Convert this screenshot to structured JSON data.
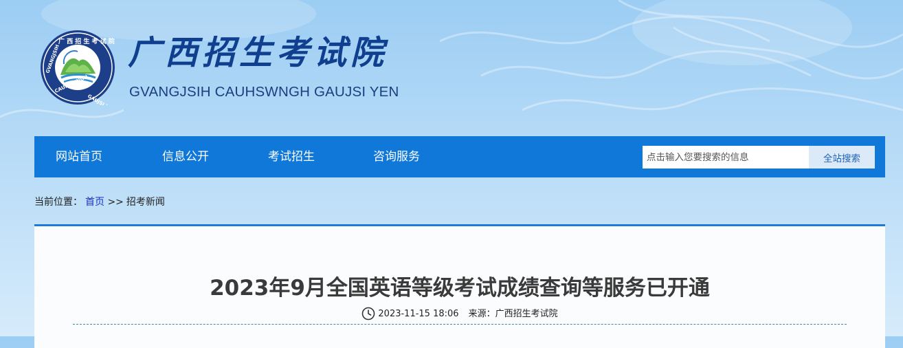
{
  "header": {
    "logo_ring_text": "GVANGJSIH CAUHSWNGH GAUJSI YEN",
    "logo_ring_cn": "广西招生考试院",
    "brand_cn": "广西招生考试院",
    "brand_en": "GVANGJSIH CAUHSWNGH GAUJSI YEN"
  },
  "nav": {
    "items": [
      {
        "label": "网站首页"
      },
      {
        "label": "信息公开"
      },
      {
        "label": "考试招生"
      },
      {
        "label": "咨询服务"
      }
    ],
    "search_placeholder": "点击输入您要搜索的信息",
    "search_button": "全站搜索"
  },
  "breadcrumb": {
    "prefix": "当前位置：",
    "home": "首页",
    "separator": ">>",
    "current": "招考新闻"
  },
  "article": {
    "title": "2023年9月全国英语等级考试成绩查询等服务已开通",
    "datetime": "2023-11-15 18:06",
    "source_label": "来源：",
    "source": "广西招生考试院"
  },
  "colors": {
    "nav_bg": "#0f78d8",
    "brand": "#0f3f8e",
    "link": "#1c30c7",
    "title": "#3a3a3a"
  },
  "icons": [
    "logo-emblem-icon",
    "clock-icon"
  ]
}
